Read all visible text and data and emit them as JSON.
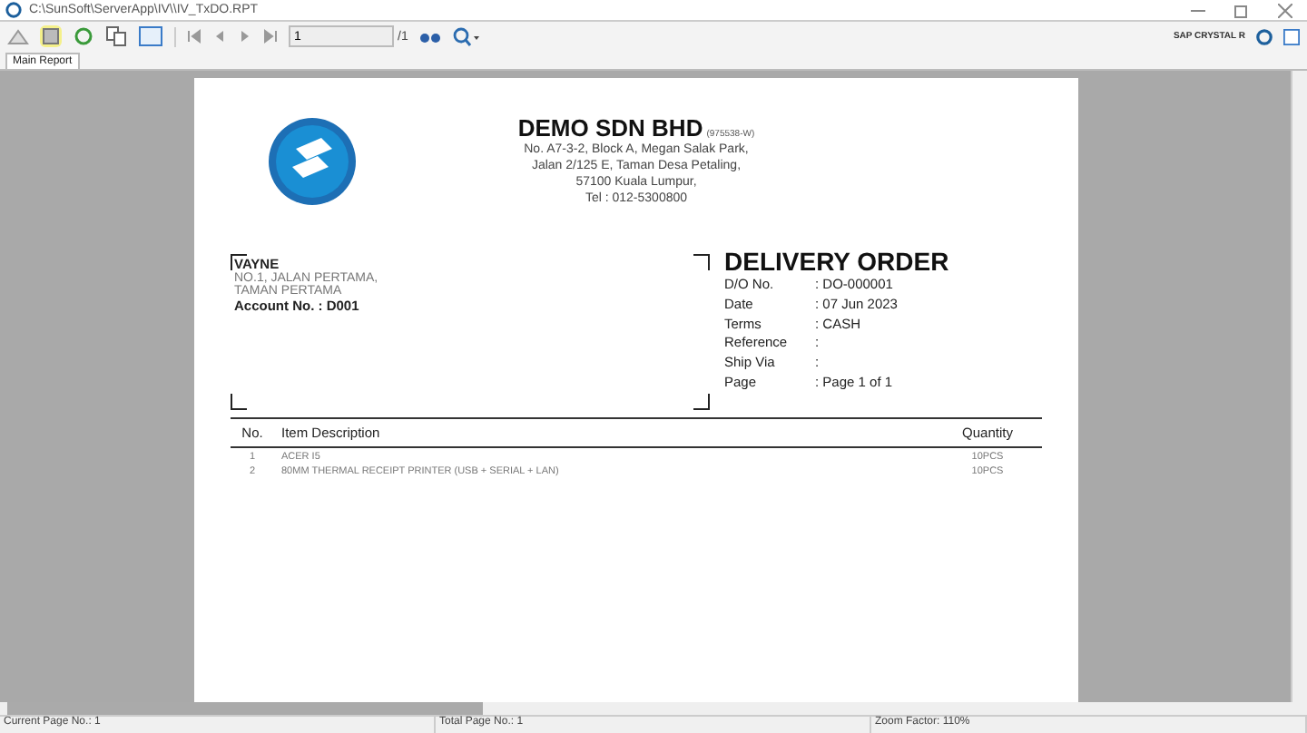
{
  "window": {
    "title": "C:\\SunSoft\\ServerApp\\IV\\\\IV_TxDO.RPT"
  },
  "toolbar": {
    "page_value": "1",
    "page_total": "/1",
    "brand": "SAP CRYSTAL R"
  },
  "tabs": [
    {
      "label": "Main Report",
      "selected": true
    }
  ],
  "report": {
    "company": {
      "name": "DEMO SDN BHD",
      "reg_no": "(975538-W)",
      "address": [
        "No. A7-3-2, Block A, Megan Salak Park,",
        "Jalan 2/125 E, Taman Desa Petaling,",
        "57100 Kuala Lumpur,",
        "Tel : 012-5300800"
      ]
    },
    "customer": {
      "name": "VAYNE",
      "address": [
        "NO.1, JALAN PERTAMA,",
        "TAMAN PERTAMA"
      ],
      "account": "Account No. : D001"
    },
    "doc_title": "DELIVERY ORDER",
    "fields": [
      {
        "label": "D/O No.",
        "value": ": DO-000001"
      },
      {
        "label": "Date",
        "value": ": 07 Jun 2023"
      },
      {
        "label": "Terms",
        "value": ": CASH"
      },
      {
        "label": "Reference",
        "value": ":"
      },
      {
        "label": "Ship Via",
        "value": ":"
      },
      {
        "label": "Page",
        "value": ": Page 1 of 1"
      }
    ],
    "columns": [
      "No.",
      "Item Description",
      "Quantity"
    ],
    "rows": [
      {
        "no": "1",
        "description": "ACER I5",
        "quantity": "10PCS"
      },
      {
        "no": "2",
        "description": "80MM THERMAL RECEIPT PRINTER (USB + SERIAL + LAN)",
        "quantity": "10PCS"
      }
    ]
  },
  "status_bar": [
    "Current Page No.: 1",
    "Total Page No.: 1",
    "Zoom Factor: 110%"
  ]
}
